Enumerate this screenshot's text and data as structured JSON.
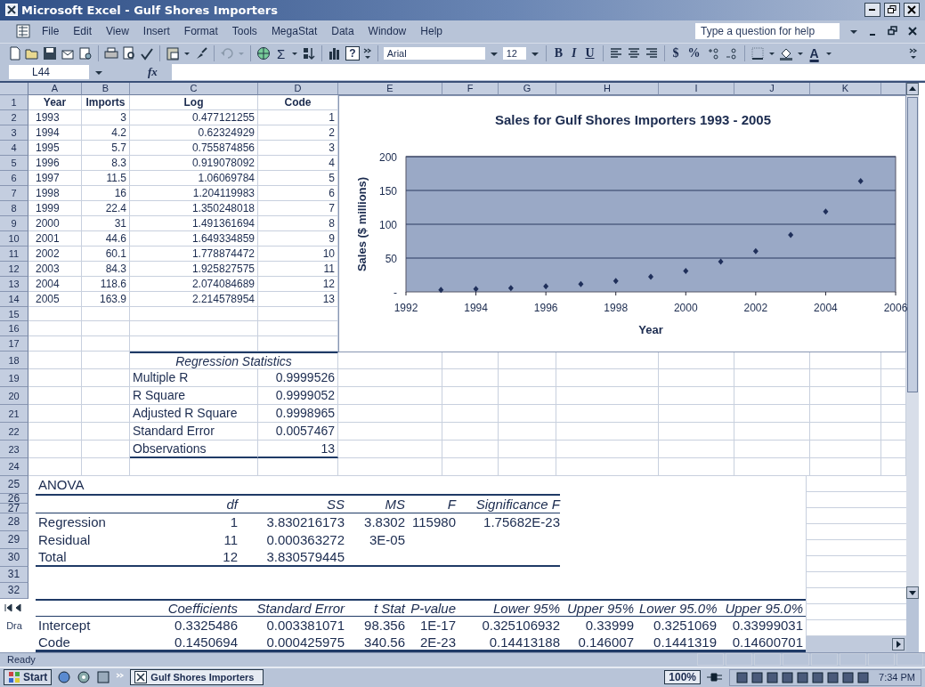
{
  "window": {
    "title": "Microsoft Excel - Gulf Shores Importers"
  },
  "menu": [
    "File",
    "Edit",
    "View",
    "Insert",
    "Format",
    "Tools",
    "MegaStat",
    "Data",
    "Window",
    "Help"
  ],
  "help_box": {
    "placeholder": "Type a question for help"
  },
  "toolbar": {
    "sum": "Σ",
    "help": "?",
    "font": "Arial",
    "size": "12",
    "bold": "B",
    "italic": "I",
    "underline": "U",
    "currency": "$",
    "percent": "%",
    "font_color": "A"
  },
  "formula_bar": {
    "name_box": "L44",
    "fx": "fx"
  },
  "column_headers": [
    "A",
    "B",
    "C",
    "D",
    "E",
    "F",
    "G",
    "H",
    "I",
    "J",
    "K"
  ],
  "row_numbers": [
    "1",
    "2",
    "3",
    "4",
    "5",
    "6",
    "7",
    "8",
    "9",
    "10",
    "11",
    "12",
    "13",
    "14",
    "15",
    "16",
    "17",
    "18",
    "19",
    "20",
    "21",
    "22",
    "23",
    "24",
    "25",
    "26",
    "27",
    "28",
    "29",
    "30",
    "31",
    "32"
  ],
  "data_table": {
    "header": [
      "Year",
      "Imports",
      "Log",
      "Code"
    ],
    "rows": [
      [
        "1993",
        "3",
        "0.477121255",
        "1"
      ],
      [
        "1994",
        "4.2",
        "0.62324929",
        "2"
      ],
      [
        "1995",
        "5.7",
        "0.755874856",
        "3"
      ],
      [
        "1996",
        "8.3",
        "0.919078092",
        "4"
      ],
      [
        "1997",
        "11.5",
        "1.06069784",
        "5"
      ],
      [
        "1998",
        "16",
        "1.204119983",
        "6"
      ],
      [
        "1999",
        "22.4",
        "1.350248018",
        "7"
      ],
      [
        "2000",
        "31",
        "1.491361694",
        "8"
      ],
      [
        "2001",
        "44.6",
        "1.649334859",
        "9"
      ],
      [
        "2002",
        "60.1",
        "1.778874472",
        "10"
      ],
      [
        "2003",
        "84.3",
        "1.925827575",
        "11"
      ],
      [
        "2004",
        "118.6",
        "2.074084689",
        "12"
      ],
      [
        "2005",
        "163.9",
        "2.214578954",
        "13"
      ]
    ]
  },
  "chart": {
    "chart_data": {
      "type": "scatter",
      "title": "Sales for Gulf Shores Importers 1993 - 2005",
      "xlabel": "Year",
      "ylabel": "Sales ($ millions)",
      "x": [
        1993,
        1994,
        1995,
        1996,
        1997,
        1998,
        1999,
        2000,
        2001,
        2002,
        2003,
        2004,
        2005
      ],
      "grid": true,
      "series": [
        {
          "color": "#1f2f5a",
          "values": [
            3,
            4.2,
            5.7,
            8.3,
            11.5,
            16,
            22.4,
            31,
            44.6,
            60.1,
            84.3,
            118.6,
            163.9
          ]
        }
      ],
      "xlim": [
        1992,
        2006
      ],
      "ylim": [
        0,
        200
      ],
      "xticks": [
        1992,
        1994,
        1996,
        1998,
        2000,
        2002,
        2004,
        2006
      ],
      "yticks": [
        {
          "value": 0,
          "label": "-"
        },
        50,
        100,
        150,
        200
      ]
    }
  },
  "regression_statistics": {
    "title": "Regression Statistics",
    "rows": [
      [
        "Multiple R",
        "0.9999526"
      ],
      [
        "R Square",
        "0.9999052"
      ],
      [
        "Adjusted R Square",
        "0.9998965"
      ],
      [
        "Standard Error",
        "0.0057467"
      ],
      [
        "Observations",
        "13"
      ]
    ]
  },
  "anova": {
    "title": "ANOVA",
    "columns": [
      "",
      "df",
      "SS",
      "MS",
      "F",
      "Significance F"
    ],
    "rows": [
      [
        "Regression",
        "1",
        "3.830216173",
        "3.8302",
        "115980",
        "1.75682E-23"
      ],
      [
        "Residual",
        "11",
        "0.000363272",
        "3E-05"
      ],
      [
        "Total",
        "12",
        "3.830579445"
      ]
    ]
  },
  "coefficients": {
    "columns": [
      "",
      "Coefficients",
      "Standard Error",
      "t Stat",
      "P-value",
      "Lower 95%",
      "Upper 95%",
      "Lower 95.0%",
      "Upper 95.0%"
    ],
    "rows": [
      [
        "Intercept",
        "0.3325486",
        "0.003381071",
        "98.356",
        "1E-17",
        "0.325106932",
        "0.33999",
        "0.3251069",
        "0.33999031"
      ],
      [
        "Code",
        "0.1450694",
        "0.000425975",
        "340.56",
        "2E-23",
        "0.14413188",
        "0.146007",
        "0.1441319",
        "0.14600701"
      ]
    ]
  },
  "draw_toolbar": {
    "label": "Dra"
  },
  "status_bar": {
    "text": "Ready"
  },
  "taskbar": {
    "start": "Start",
    "task": "Gulf Shores Importers",
    "zoom": "100%",
    "clock": "7:34 PM"
  }
}
